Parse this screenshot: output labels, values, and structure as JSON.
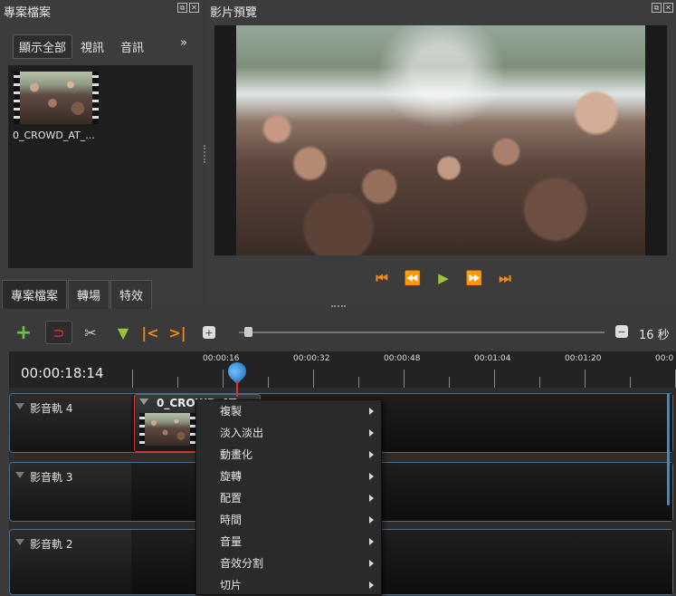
{
  "project_panel": {
    "title": "專案檔案",
    "filters": [
      "顯示全部",
      "視訊",
      "音訊"
    ],
    "overflow": "»",
    "file": {
      "name": "0_CROWD_AT_..."
    },
    "tabs": [
      "專案檔案",
      "轉場",
      "特效"
    ]
  },
  "preview_panel": {
    "title": "影片預覽",
    "transport": [
      "jump-start",
      "rewind",
      "play",
      "fast-forward",
      "jump-end"
    ]
  },
  "timeline": {
    "zoom_label": "16 秒",
    "current_time": "00:00:18:14",
    "ruler_labels": [
      "00:00:16",
      "00:00:32",
      "00:00:48",
      "00:01:04",
      "00:01:20",
      "00:0"
    ],
    "tracks": [
      {
        "name": "影音軌 4"
      },
      {
        "name": "影音軌 3"
      },
      {
        "name": "影音軌 2"
      }
    ],
    "clip": {
      "name": "0_CROWD_AT_..."
    }
  },
  "context_menu": {
    "items": [
      "複製",
      "淡入淡出",
      "動畫化",
      "旋轉",
      "配置",
      "時間",
      "音量",
      "音效分割",
      "切片"
    ]
  },
  "colors": {
    "accent_orange": "#f08a1a",
    "play_green": "#9ac43a",
    "track_border": "#4a6e8a",
    "clip_border": "#cc3333",
    "playhead_blue": "#2a8ad8"
  }
}
